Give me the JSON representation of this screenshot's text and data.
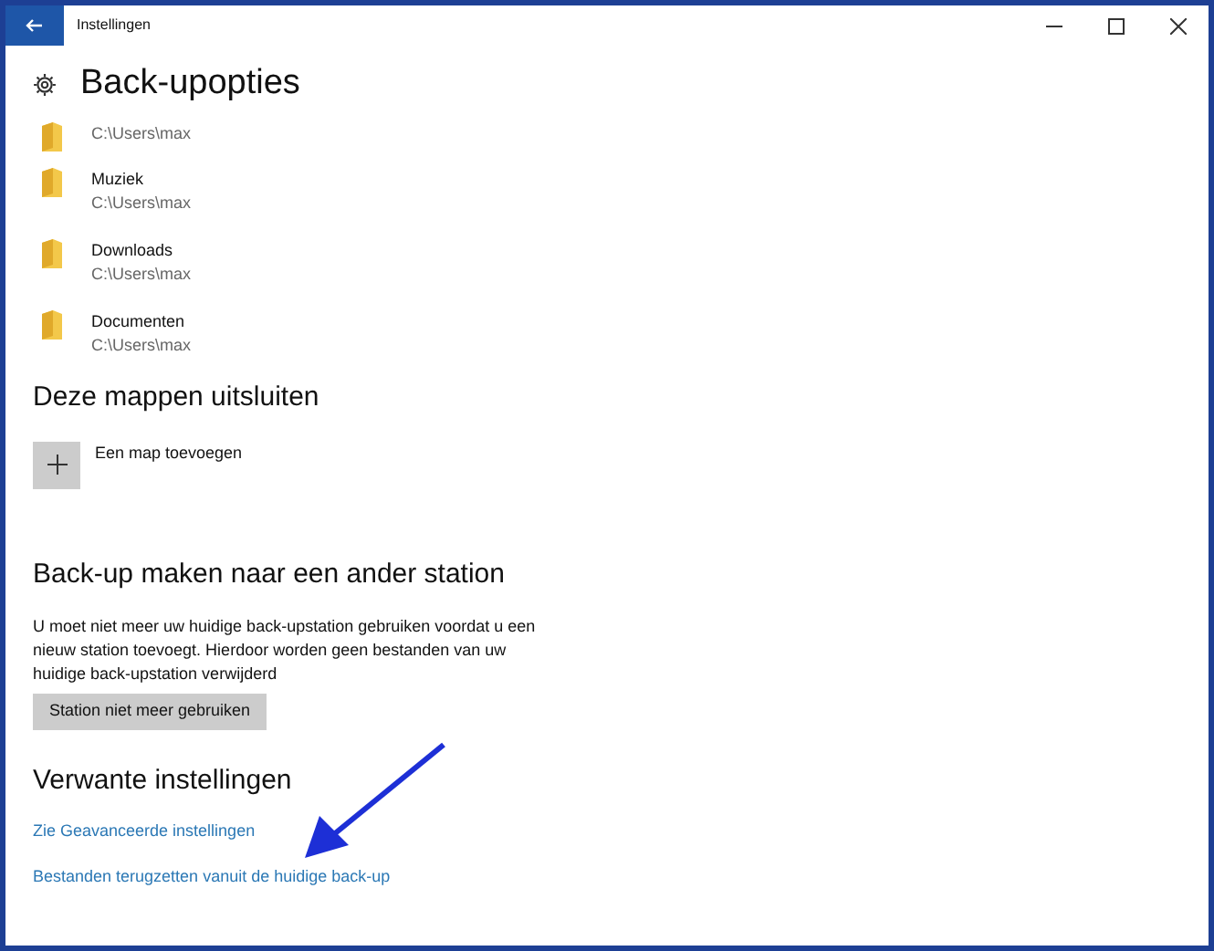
{
  "window": {
    "title": "Instellingen"
  },
  "page_title": "Back-upopties",
  "folders": [
    {
      "path": "C:\\Users\\max"
    },
    {
      "name": "Muziek",
      "path": "C:\\Users\\max"
    },
    {
      "name": "Downloads",
      "path": "C:\\Users\\max"
    },
    {
      "name": "Documenten",
      "path": "C:\\Users\\max"
    }
  ],
  "exclude": {
    "heading": "Deze mappen uitsluiten",
    "add_label": "Een map toevoegen"
  },
  "other_drive": {
    "heading": "Back-up maken naar een ander station",
    "description": "U moet niet meer uw huidige back-upstation gebruiken voordat u een nieuw station toevoegt. Hierdoor worden geen bestanden van uw huidige back-upstation verwijderd",
    "button": "Station niet meer gebruiken"
  },
  "related": {
    "heading": "Verwante instellingen",
    "links": [
      "Zie Geavanceerde instellingen",
      "Bestanden terugzetten vanuit de huidige back-up"
    ]
  }
}
